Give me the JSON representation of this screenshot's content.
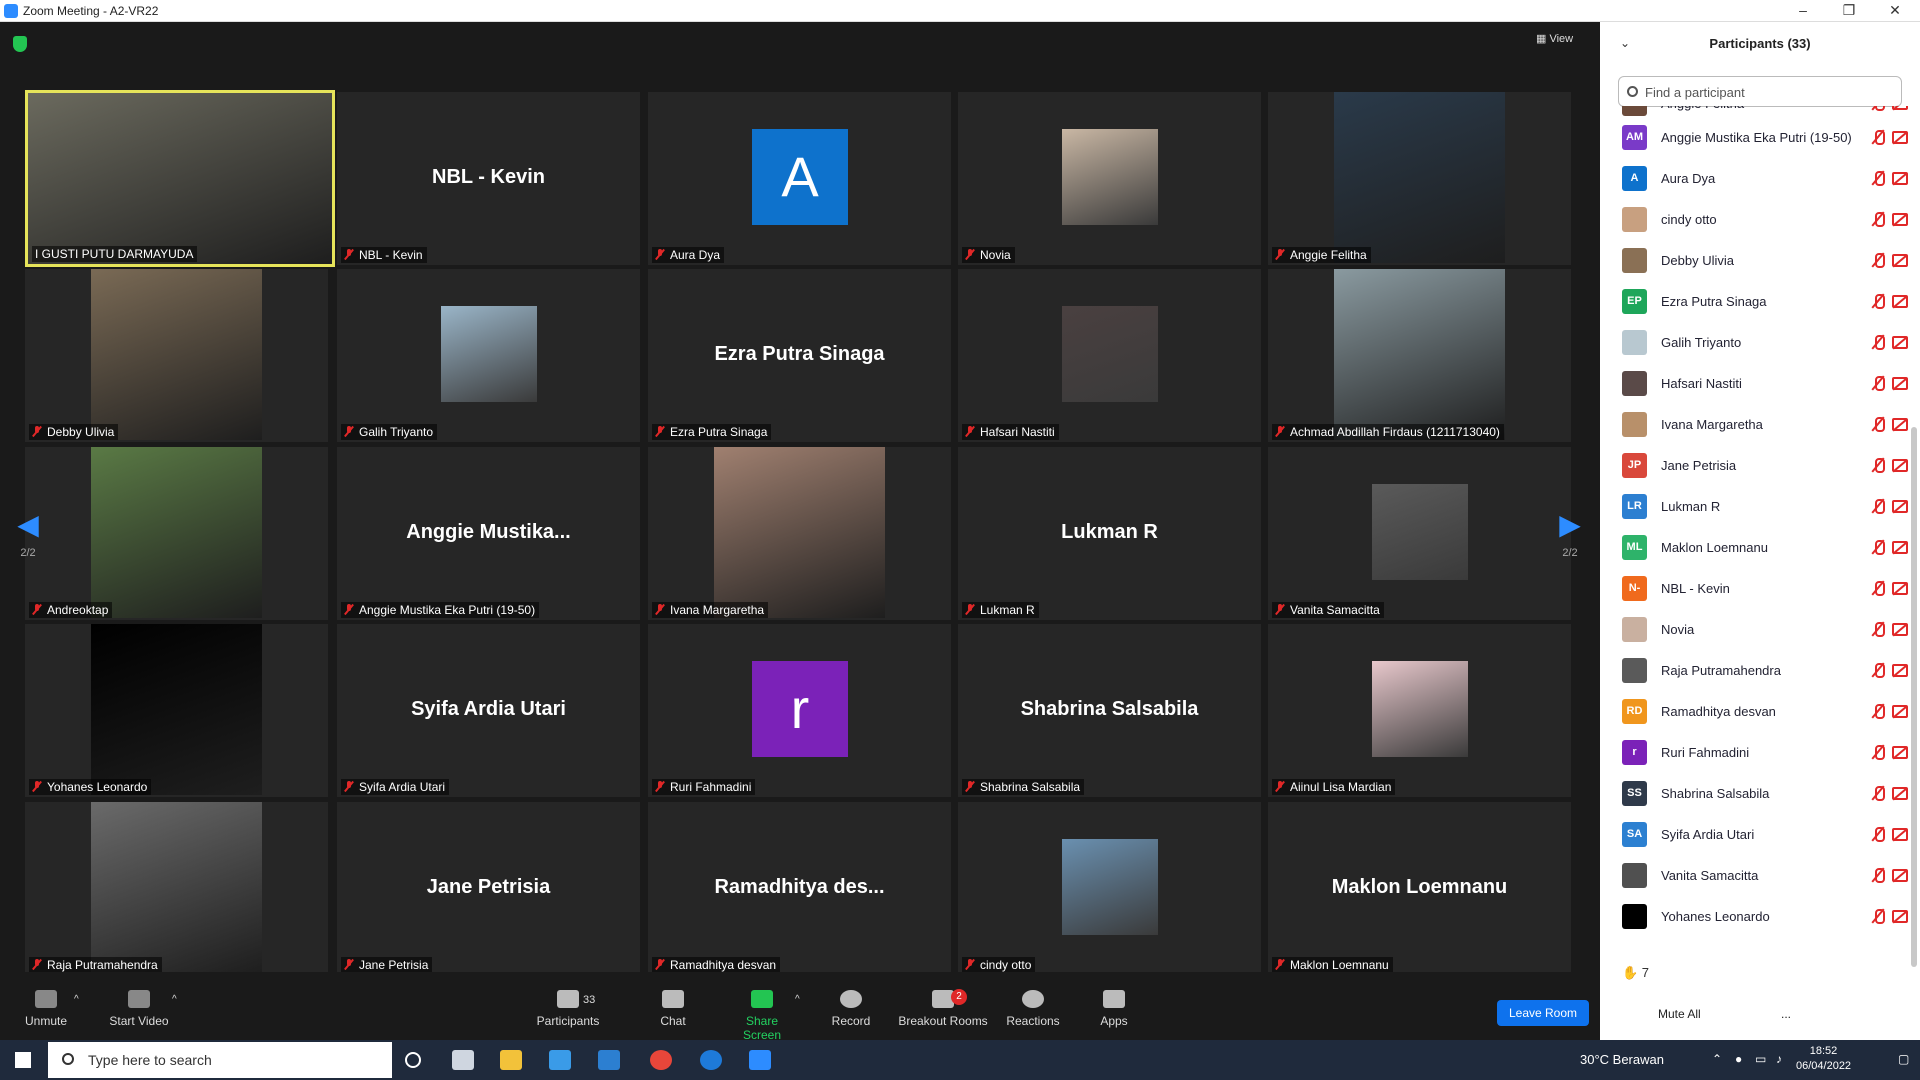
{
  "window": {
    "title": "Zoom Meeting - A2-VR22",
    "minimize": "–",
    "maximize": "❐",
    "close": "✕"
  },
  "view_label": "View",
  "pager": {
    "left": "2/2",
    "right": "2/2",
    "left_glyph": "◀",
    "right_glyph": "▶"
  },
  "colors": {
    "accent": "#2d8cff",
    "mute_red": "#e02828",
    "active_border": "#e6e45a",
    "leave": "#0e72ed"
  },
  "tiles": [
    {
      "name": "I GUSTI PUTU DARMAYUDA",
      "kind": "video",
      "active": true,
      "tint": "#6b6a5e"
    },
    {
      "name": "NBL - Kevin",
      "kind": "name",
      "display": "NBL - Kevin"
    },
    {
      "name": "Aura Dya",
      "kind": "avatar",
      "letter": "A",
      "color": "#0e72cc"
    },
    {
      "name": "Novia",
      "kind": "thumb",
      "tint": "#c9b7a4"
    },
    {
      "name": "Anggie Felitha",
      "kind": "video",
      "tint": "#2a3a4a"
    },
    {
      "name": "Debby Ulivia",
      "kind": "video",
      "tint": "#7a6a55"
    },
    {
      "name": "Galih Triyanto",
      "kind": "thumb",
      "tint": "#9ab5c8"
    },
    {
      "name": "Ezra Putra Sinaga",
      "kind": "name",
      "display": "Ezra Putra Sinaga"
    },
    {
      "name": "Hafsari Nastiti",
      "kind": "thumb",
      "tint": "#4a4040"
    },
    {
      "name": "Achmad Abdillah Firdaus (1211713040)",
      "kind": "video",
      "tint": "#8a9aa0"
    },
    {
      "name": "Andreoktap",
      "kind": "video",
      "tint": "#5a7a45"
    },
    {
      "name": "Anggie Mustika Eka Putri (19-50)",
      "kind": "name",
      "display": "Anggie  Mustika..."
    },
    {
      "name": "Ivana Margaretha",
      "kind": "video",
      "tint": "#a08070"
    },
    {
      "name": "Lukman R",
      "kind": "name",
      "display": "Lukman R"
    },
    {
      "name": "Vanita Samacitta",
      "kind": "thumb",
      "tint": "#5a5a5a"
    },
    {
      "name": "Yohanes Leonardo",
      "kind": "video",
      "tint": "#000000"
    },
    {
      "name": "Syifa Ardia Utari",
      "kind": "name",
      "display": "Syifa Ardia Utari"
    },
    {
      "name": "Ruri Fahmadini",
      "kind": "avatar",
      "letter": "r",
      "color": "#7b22b8"
    },
    {
      "name": "Shabrina Salsabila",
      "kind": "name",
      "display": "Shabrina Salsabila"
    },
    {
      "name": "Aiinul Lisa Mardian",
      "kind": "thumb",
      "tint": "#e8c8cc"
    },
    {
      "name": "Raja Putramahendra",
      "kind": "video",
      "tint": "#6a6a6a"
    },
    {
      "name": "Jane Petrisia",
      "kind": "name",
      "display": "Jane Petrisia"
    },
    {
      "name": "Ramadhitya desvan",
      "kind": "name",
      "display": "Ramadhitya  des..."
    },
    {
      "name": "cindy otto",
      "kind": "thumb",
      "tint": "#6a90b0"
    },
    {
      "name": "Maklon Loemnanu",
      "kind": "name",
      "display": "Maklon Loemnanu"
    }
  ],
  "toolbar": {
    "unmute": "Unmute",
    "start_video": "Start Video",
    "participants": "Participants",
    "participants_count": "33",
    "chat": "Chat",
    "share": "Share Screen",
    "record": "Record",
    "breakout": "Breakout Rooms",
    "breakout_badge": "2",
    "reactions": "Reactions",
    "apps": "Apps",
    "leave": "Leave Room",
    "caret": "^"
  },
  "panel": {
    "title": "Participants (33)",
    "collapse": "⌄",
    "search_placeholder": "Find a participant",
    "participants": [
      {
        "name": "Anggie Felitha",
        "initials": "",
        "color": "#6b4a3a"
      },
      {
        "name": "Anggie Mustika Eka Putri (19-50)",
        "initials": "AM",
        "color": "#7a3ac8"
      },
      {
        "name": "Aura Dya",
        "initials": "A",
        "color": "#0e72cc"
      },
      {
        "name": "cindy otto",
        "initials": "",
        "color": "#c8a080"
      },
      {
        "name": "Debby Ulivia",
        "initials": "",
        "color": "#8a7055"
      },
      {
        "name": "Ezra Putra Sinaga",
        "initials": "EP",
        "color": "#1ea65a"
      },
      {
        "name": "Galih Triyanto",
        "initials": "",
        "color": "#b8c8d0"
      },
      {
        "name": "Hafsari Nastiti",
        "initials": "",
        "color": "#5a4a48"
      },
      {
        "name": "Ivana Margaretha",
        "initials": "",
        "color": "#b8906a"
      },
      {
        "name": "Jane Petrisia",
        "initials": "JP",
        "color": "#d9483b"
      },
      {
        "name": "Lukman R",
        "initials": "LR",
        "color": "#2c7fd1"
      },
      {
        "name": "Maklon Loemnanu",
        "initials": "ML",
        "color": "#2eb36a"
      },
      {
        "name": "NBL - Kevin",
        "initials": "N-",
        "color": "#f06a1d"
      },
      {
        "name": "Novia",
        "initials": "",
        "color": "#c9b0a0"
      },
      {
        "name": "Raja Putramahendra",
        "initials": "",
        "color": "#5a5a5a"
      },
      {
        "name": "Ramadhitya desvan",
        "initials": "RD",
        "color": "#f0961d"
      },
      {
        "name": "Ruri Fahmadini",
        "initials": "r",
        "color": "#7b22b8"
      },
      {
        "name": "Shabrina Salsabila",
        "initials": "SS",
        "color": "#2f3a4a"
      },
      {
        "name": "Syifa Ardia Utari",
        "initials": "SA",
        "color": "#2c80d1"
      },
      {
        "name": "Vanita Samacitta",
        "initials": "",
        "color": "#505050"
      },
      {
        "name": "Yohanes Leonardo",
        "initials": "",
        "color": "#000000"
      }
    ],
    "raised_hands": "✋ 7",
    "mute_all": "Mute All",
    "more": "..."
  },
  "taskbar": {
    "search_placeholder": "Type here to search",
    "weather": "30°C  Berawan",
    "time": "18:52",
    "date": "06/04/2022"
  }
}
